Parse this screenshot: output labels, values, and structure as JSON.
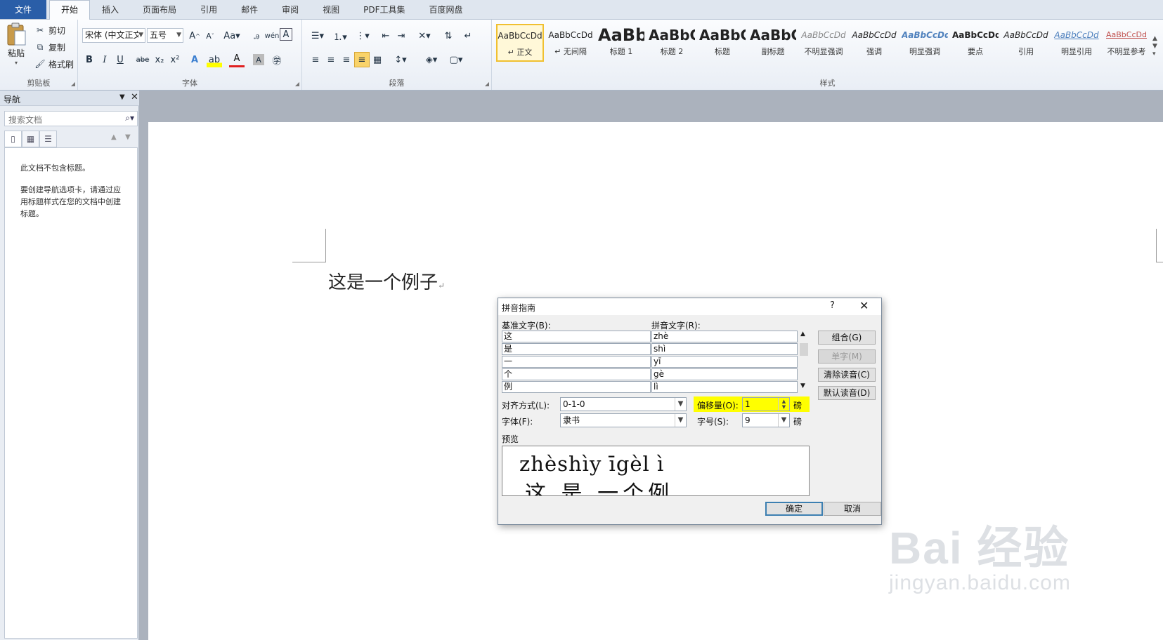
{
  "tabs": [
    "文件",
    "开始",
    "插入",
    "页面布局",
    "引用",
    "邮件",
    "审阅",
    "视图",
    "PDF工具集",
    "百度网盘"
  ],
  "clipboard": {
    "paste": "粘贴",
    "cut": "剪切",
    "copy": "复制",
    "format_painter": "格式刷",
    "group": "剪贴板"
  },
  "font": {
    "name": "宋体 (中文正文)",
    "size": "五号",
    "group": "字体",
    "buttons": [
      "B",
      "I",
      "U",
      "abe",
      "x₂",
      "x²",
      "A",
      "A",
      "A"
    ]
  },
  "paragraph": {
    "group": "段落"
  },
  "styles": {
    "group": "样式",
    "items": [
      {
        "sample": "AaBbCcDd",
        "name": "↵ 正文"
      },
      {
        "sample": "AaBbCcDd",
        "name": "↵ 无间隔"
      },
      {
        "sample": "AaBb",
        "name": "标题 1"
      },
      {
        "sample": "AaBbC",
        "name": "标题 2"
      },
      {
        "sample": "AaBbC",
        "name": "标题"
      },
      {
        "sample": "AaBbC",
        "name": "副标题"
      },
      {
        "sample": "AaBbCcDd",
        "name": "不明显强调"
      },
      {
        "sample": "AaBbCcDd",
        "name": "强调"
      },
      {
        "sample": "AaBbCcDd",
        "name": "明显强调"
      },
      {
        "sample": "AaBbCcDd",
        "name": "要点"
      },
      {
        "sample": "AaBbCcDd",
        "name": "引用"
      },
      {
        "sample": "AaBbCcDd",
        "name": "明显引用"
      },
      {
        "sample": "AaBbCcDd",
        "name": "不明显参考"
      }
    ]
  },
  "nav": {
    "title": "导航",
    "search_placeholder": "搜索文档",
    "no_headings": "此文档不包含标题。",
    "help": "要创建导航选项卡，请通过应用标题样式在您的文档中创建标题。"
  },
  "document": {
    "text": "这是一个例子"
  },
  "watermark": {
    "main": "Bai 经验",
    "sub": "jingyan.baidu.com"
  },
  "dialog": {
    "title": "拼音指南",
    "help": "?",
    "base_label": "基准文字(B):",
    "ruby_label": "拼音文字(R):",
    "rows": [
      {
        "base": "这",
        "ruby": "zhè"
      },
      {
        "base": "是",
        "ruby": "shì"
      },
      {
        "base": "一",
        "ruby": "yī"
      },
      {
        "base": "个",
        "ruby": "gè"
      },
      {
        "base": "例",
        "ruby": "lì"
      }
    ],
    "btn_group": "组合(G)",
    "btn_single": "单字(M)",
    "btn_clear": "清除读音(C)",
    "btn_default": "默认读音(D)",
    "align_label": "对齐方式(L):",
    "align_value": "0-1-0",
    "offset_label": "偏移量(O):",
    "offset_value": "1",
    "unit": "磅",
    "font_label": "字体(F):",
    "font_value": "隶书",
    "size_label": "字号(S):",
    "size_value": "9",
    "preview_label": "预览",
    "preview_pinyin": "zhèshìy īgèl ì",
    "preview_base": "这 是 一个例",
    "ok": "确定",
    "cancel": "取消",
    "highlight_color": "#ffff00"
  }
}
